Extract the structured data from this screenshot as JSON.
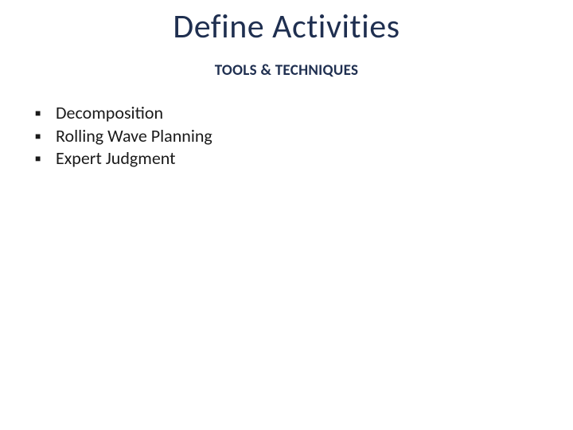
{
  "slide": {
    "title": "Define Activities",
    "subtitle": "TOOLS & TECHNIQUES",
    "bullets": [
      "Decomposition",
      "Rolling Wave Planning",
      "Expert Judgment"
    ]
  }
}
